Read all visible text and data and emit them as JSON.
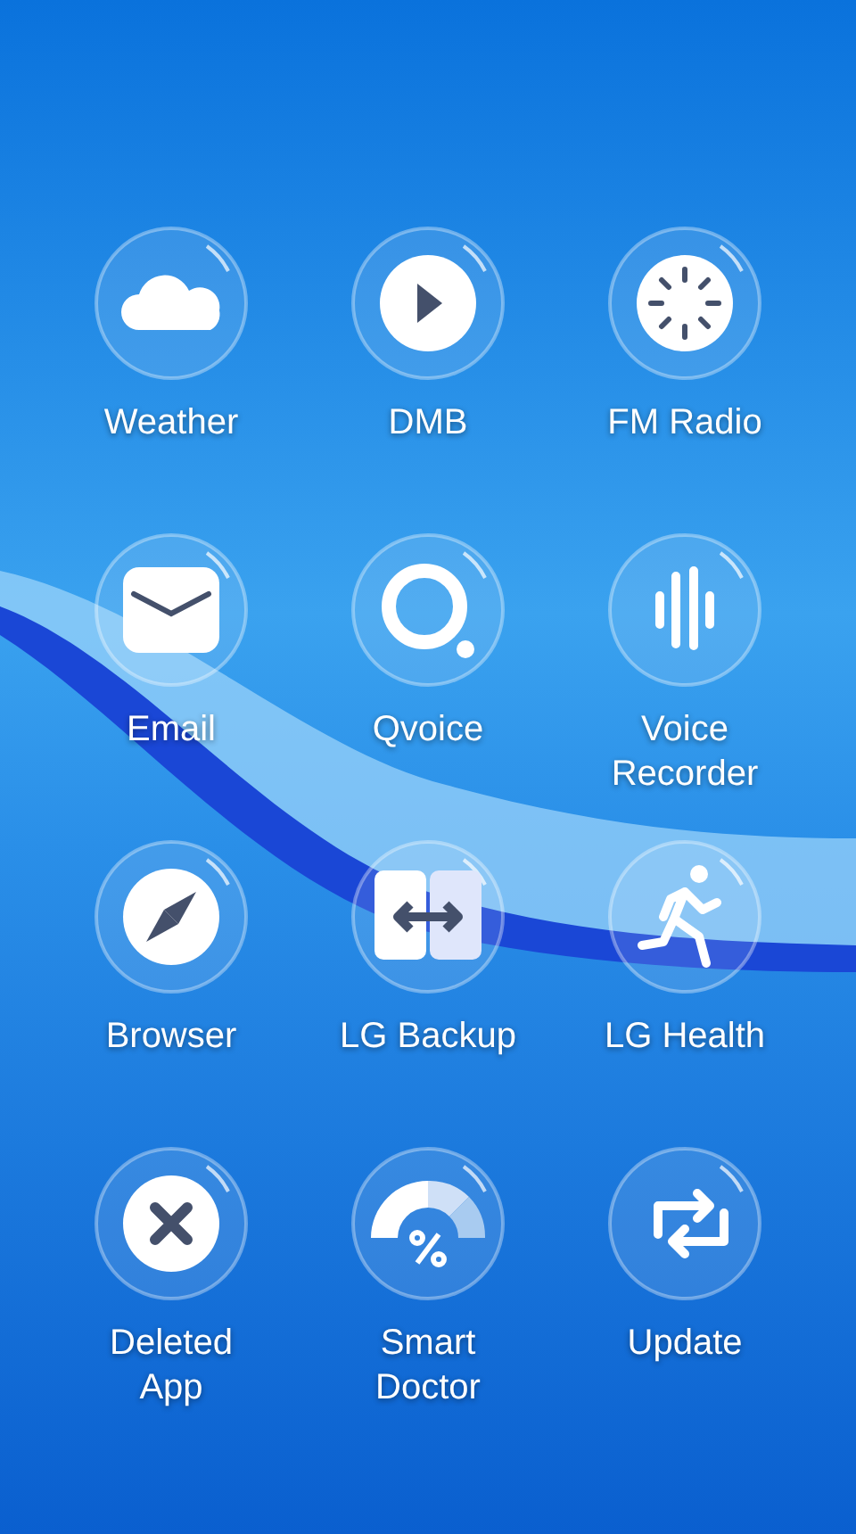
{
  "apps": [
    {
      "label": "Weather",
      "kind": "cloud"
    },
    {
      "label": "DMB",
      "kind": "play"
    },
    {
      "label": "FM Radio",
      "kind": "dial"
    },
    {
      "label": "Email",
      "kind": "mail"
    },
    {
      "label": "Qvoice",
      "kind": "ring"
    },
    {
      "label": "Voice\nRecorder",
      "kind": "bars"
    },
    {
      "label": "Browser",
      "kind": "compass"
    },
    {
      "label": "LG Backup",
      "kind": "transfer"
    },
    {
      "label": "LG Health",
      "kind": "runner"
    },
    {
      "label": "Deleted\nApp",
      "kind": "cross"
    },
    {
      "label": "Smart\nDoctor",
      "kind": "gauge"
    },
    {
      "label": "Update",
      "kind": "sync"
    }
  ]
}
